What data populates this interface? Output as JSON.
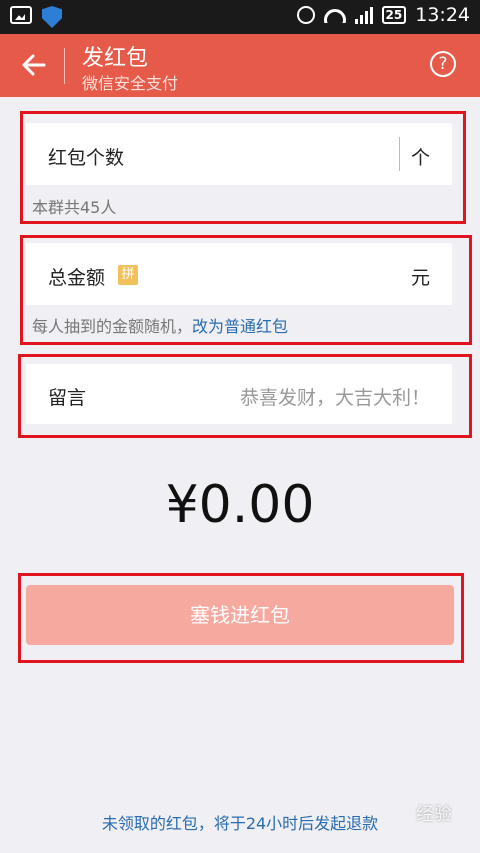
{
  "statusbar": {
    "battery": "25",
    "time": "13:24"
  },
  "header": {
    "title": "发红包",
    "subtitle": "微信安全支付",
    "help": "?"
  },
  "count_field": {
    "label": "红包个数",
    "unit": "个",
    "note": "本群共45人"
  },
  "amount_field": {
    "label": "总金额",
    "badge": "拼",
    "unit": "元",
    "note": "每人抽到的金额随机，",
    "switch_link": "改为普通红包"
  },
  "message_field": {
    "label": "留言",
    "placeholder": "恭喜发财，大吉大利！"
  },
  "total": {
    "value": "¥0.00"
  },
  "submit": {
    "label": "塞钱进红包"
  },
  "footer": {
    "note": "未领取的红包，将于24小时后发起退款"
  },
  "watermark": {
    "text": "经验"
  },
  "colors": {
    "header": "#e65a4a",
    "button": "#f6a99f",
    "link": "#2a6cb0",
    "highlight": "#e0141e"
  }
}
